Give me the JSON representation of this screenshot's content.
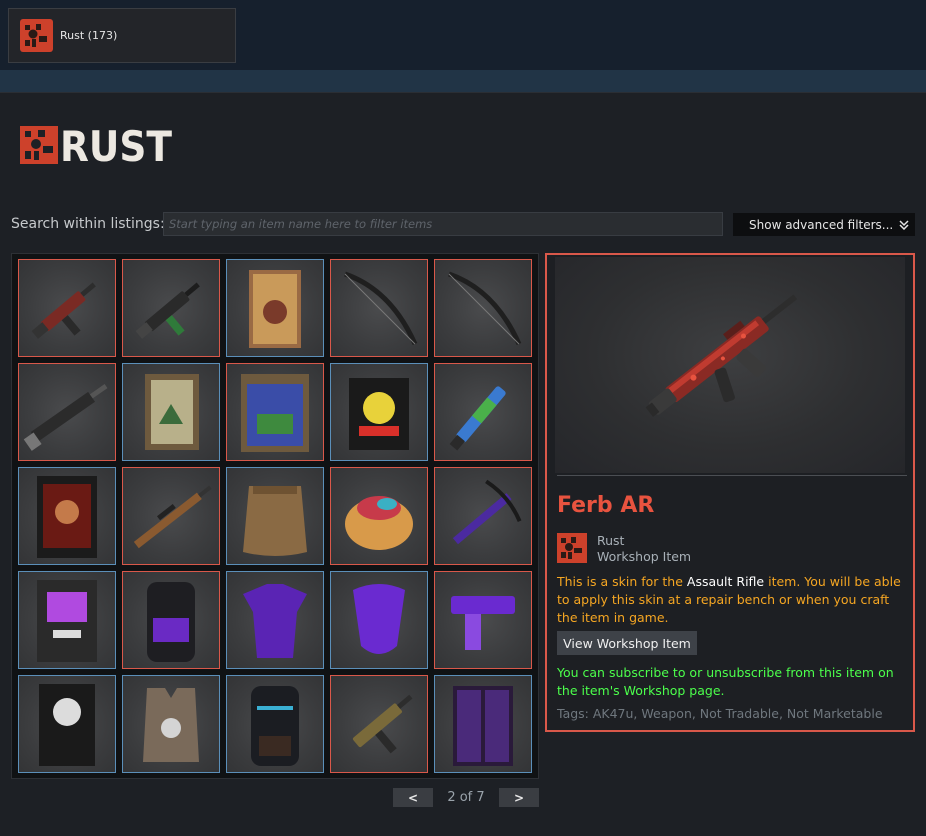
{
  "game_tab": {
    "label": "Rust (173)",
    "icon": "rust-icon"
  },
  "logo": {
    "text": "RUST",
    "icon": "rust-logo-icon"
  },
  "search": {
    "label": "Search within listings:",
    "placeholder": "Start typing an item name here to filter items",
    "value": ""
  },
  "advanced_filters": {
    "label": "Show advanced filters...",
    "icon": "double-chevron-down-icon"
  },
  "grid": {
    "items": [
      {
        "kind": "smg-red",
        "border": "red"
      },
      {
        "kind": "smg-green",
        "border": "red"
      },
      {
        "kind": "poster",
        "border": "blue"
      },
      {
        "kind": "bow",
        "border": "red"
      },
      {
        "kind": "bow",
        "border": "red"
      },
      {
        "kind": "rifle-gray",
        "border": "red"
      },
      {
        "kind": "picture-frame",
        "border": "blue"
      },
      {
        "kind": "picture-frame-blue",
        "border": "red"
      },
      {
        "kind": "neon-sign",
        "border": "blue"
      },
      {
        "kind": "shotgun-blue",
        "border": "red"
      },
      {
        "kind": "banner",
        "border": "blue"
      },
      {
        "kind": "sniper",
        "border": "red"
      },
      {
        "kind": "sack",
        "border": "blue"
      },
      {
        "kind": "food",
        "border": "red"
      },
      {
        "kind": "crossbow",
        "border": "red"
      },
      {
        "kind": "vending",
        "border": "blue"
      },
      {
        "kind": "backpack-purple",
        "border": "red"
      },
      {
        "kind": "shirt-purple",
        "border": "blue"
      },
      {
        "kind": "bandana",
        "border": "blue"
      },
      {
        "kind": "pistol-purple",
        "border": "red"
      },
      {
        "kind": "flag-card",
        "border": "blue"
      },
      {
        "kind": "vest",
        "border": "blue"
      },
      {
        "kind": "backpack-blue",
        "border": "blue"
      },
      {
        "kind": "smg-tan",
        "border": "red"
      },
      {
        "kind": "locker",
        "border": "blue"
      }
    ]
  },
  "pagination": {
    "prev": "<",
    "next": ">",
    "text": "2 of 7"
  },
  "detail": {
    "title": "Ferb AR",
    "game": "Rust",
    "type": "Workshop Item",
    "desc_before": "This is a skin for the ",
    "desc_item": "Assault Rifle",
    "desc_after": " item. You will be able to apply this skin at a repair bench or when you craft the item in game.",
    "button": "View Workshop Item",
    "subscribe_note": "You can subscribe to or unsubscribe from this item on the item's Workshop page.",
    "tags": "Tags: AK47u, Weapon, Not Tradable, Not Marketable"
  },
  "colors": {
    "accent": "#d9584a",
    "title": "#e8533f",
    "description": "#f5a623",
    "subscribe": "#4cff4c",
    "rust_red": "#cd412b"
  }
}
